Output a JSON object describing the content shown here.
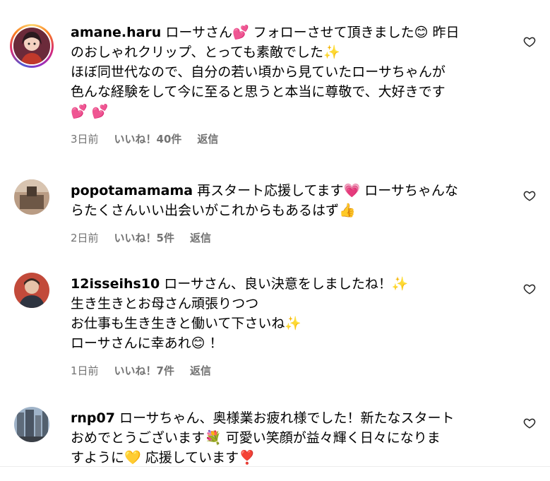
{
  "comments": [
    {
      "username": "amane.haru",
      "lines": [
        "ローサさん💕 フォローさせて頂きました😊 昨日",
        "のおしゃれクリップ、とっても素敵でした✨",
        "ほぼ同世代なので、自分の若い頃から見ていたローサちゃんが",
        "色んな経験をして今に至ると思うと本当に尊敬で、大好きです",
        "💕 💕"
      ],
      "time": "3日前",
      "likes": "いいね！40件",
      "reply": "返信"
    },
    {
      "username": "popotamamama",
      "lines": [
        "再スタート応援してます💗 ローサちゃんな",
        "らたくさんいい出会いがこれからもあるはず👍"
      ],
      "time": "2日前",
      "likes": "いいね！5件",
      "reply": "返信"
    },
    {
      "username": "12isseihs10",
      "lines": [
        "ローサさん、良い決意をしましたね！✨",
        "生き生きとお母さん頑張りつつ",
        "お仕事も生き生きと働いて下さいね✨",
        "ローサさんに幸あれ😊 ！"
      ],
      "time": "1日前",
      "likes": "いいね！7件",
      "reply": "返信"
    },
    {
      "username": "rnp07",
      "lines": [
        "ローサちゃん、奥様業お疲れ様でした！新たなスタート",
        "おめでとうございます💐 可愛い笑顔が益々輝く日々になりま",
        "すように💛 応援しています❣️"
      ]
    }
  ],
  "icons": {
    "like": "heart-outline-icon"
  },
  "colors": {
    "meta_text": "#737373",
    "story_ring": "#d62976"
  }
}
